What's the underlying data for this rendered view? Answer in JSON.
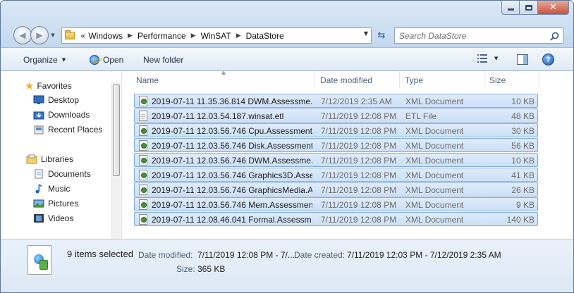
{
  "address": {
    "overflow_chevron": "«",
    "crumbs": [
      "Windows",
      "Performance",
      "WinSAT",
      "DataStore"
    ]
  },
  "search": {
    "placeholder": "Search DataStore"
  },
  "toolbar": {
    "organize": "Organize",
    "open": "Open",
    "new_folder": "New folder"
  },
  "nav": {
    "favorites": "Favorites",
    "desktop": "Desktop",
    "downloads": "Downloads",
    "recent_places": "Recent Places",
    "libraries": "Libraries",
    "documents": "Documents",
    "music": "Music",
    "pictures": "Pictures",
    "videos": "Videos"
  },
  "columns": {
    "name": "Name",
    "date_modified": "Date modified",
    "type": "Type",
    "size": "Size"
  },
  "files": [
    {
      "name": "2019-07-11 11.35.36.814 DWM.Assessme...",
      "date": "7/12/2019 2:35 AM",
      "type": "XML Document",
      "size": "10 KB",
      "icon": "xml-icon"
    },
    {
      "name": "2019-07-11 12.03.54.187.winsat.etl",
      "date": "7/11/2019 12:08 PM",
      "type": "ETL File",
      "size": "48 KB",
      "icon": "etl-icon"
    },
    {
      "name": "2019-07-11 12.03.56.746 Cpu.Assessment ...",
      "date": "7/11/2019 12:08 PM",
      "type": "XML Document",
      "size": "30 KB",
      "icon": "xml-icon"
    },
    {
      "name": "2019-07-11 12.03.56.746 Disk.Assessment ...",
      "date": "7/11/2019 12:08 PM",
      "type": "XML Document",
      "size": "56 KB",
      "icon": "xml-icon"
    },
    {
      "name": "2019-07-11 12.03.56.746 DWM.Assessme...",
      "date": "7/11/2019 12:08 PM",
      "type": "XML Document",
      "size": "10 KB",
      "icon": "xml-icon"
    },
    {
      "name": "2019-07-11 12.03.56.746 Graphics3D.Asse...",
      "date": "7/11/2019 12:08 PM",
      "type": "XML Document",
      "size": "41 KB",
      "icon": "xml-icon"
    },
    {
      "name": "2019-07-11 12.03.56.746 GraphicsMedia.A...",
      "date": "7/11/2019 12:08 PM",
      "type": "XML Document",
      "size": "26 KB",
      "icon": "xml-icon"
    },
    {
      "name": "2019-07-11 12.03.56.746 Mem.Assessmen...",
      "date": "7/11/2019 12:08 PM",
      "type": "XML Document",
      "size": "9 KB",
      "icon": "xml-icon"
    },
    {
      "name": "2019-07-11 12.08.46.041 Formal.Assessm...",
      "date": "7/11/2019 12:08 PM",
      "type": "XML Document",
      "size": "140 KB",
      "icon": "xml-icon"
    }
  ],
  "details": {
    "selection": "9 items selected",
    "date_modified_label": "Date modified:",
    "date_modified_value": "7/11/2019 12:08 PM - 7/...",
    "date_created_label": "Date created:",
    "date_created_value": "7/11/2019 12:03 PM - 7/12/2019 2:35 AM",
    "size_label": "Size:",
    "size_value": "365 KB"
  }
}
